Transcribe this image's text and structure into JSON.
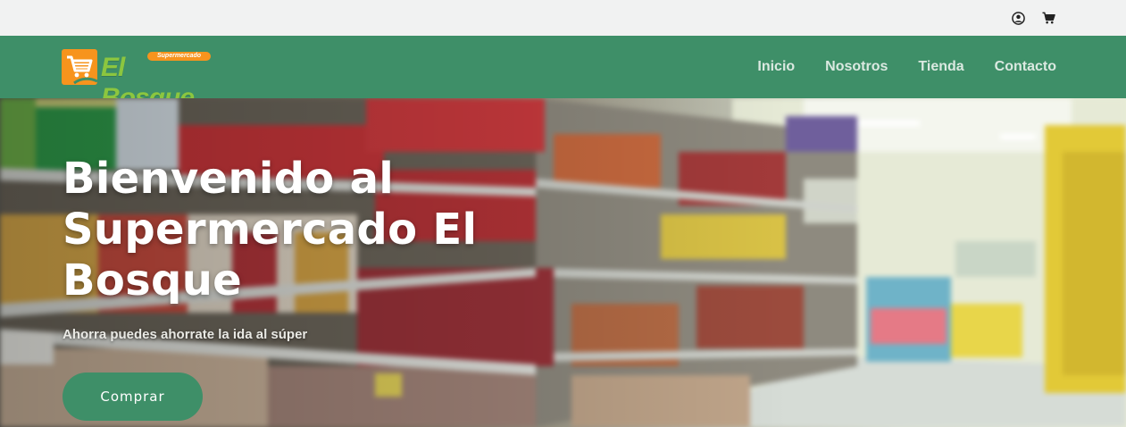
{
  "topbar": {
    "icons": [
      {
        "name": "user-icon"
      },
      {
        "name": "cart-icon"
      }
    ]
  },
  "header": {
    "logo": {
      "small_text": "Supermercado",
      "big_text": "El Bosque"
    },
    "nav": [
      {
        "label": "Inicio"
      },
      {
        "label": "Nosotros"
      },
      {
        "label": "Tienda"
      },
      {
        "label": "Contacto"
      }
    ],
    "colors": {
      "primary": "#3e8f68",
      "accent": "#f7941d",
      "logo_green": "#8cc63f"
    }
  },
  "hero": {
    "title": "Bienvenido al Supermercado El Bosque",
    "subtitle": "Ahorra puedes ahorrate la ida al súper",
    "button_label": "Comprar"
  }
}
